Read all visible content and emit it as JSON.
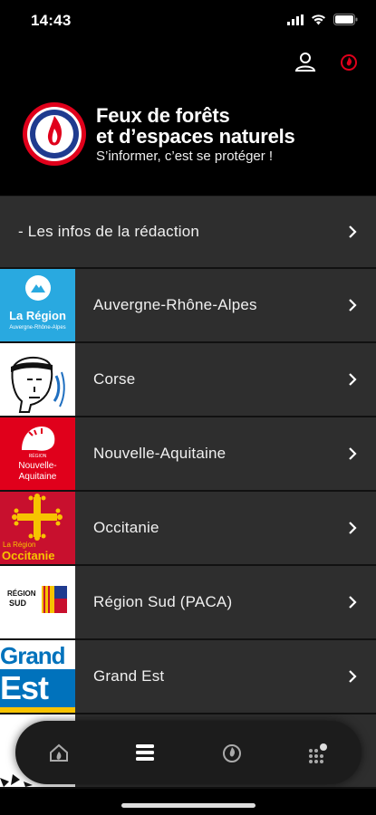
{
  "status": {
    "time": "14:43"
  },
  "header": {
    "title_line1": "Feux de forêts",
    "title_line2": "et d’espaces naturels",
    "tagline": "S’informer, c’est se protéger !"
  },
  "list": {
    "items": [
      {
        "label": "- Les infos de la rédaction"
      },
      {
        "label": "Auvergne-Rhône-Alpes",
        "logo_text": "La Région",
        "logo_sub": "Auvergne-Rhône-Alpes"
      },
      {
        "label": "Corse"
      },
      {
        "label": "Nouvelle-Aquitaine",
        "logo_text": "Nouvelle-",
        "logo_text2": "Aquitaine",
        "logo_small": "RÉGION"
      },
      {
        "label": "Occitanie",
        "logo_text": "La Région",
        "logo_text2": "Occitanie"
      },
      {
        "label": "Région Sud (PACA)",
        "logo_text": "RÉGION",
        "logo_text2": "SUD"
      },
      {
        "label": "Grand Est",
        "logo_text": "Grand",
        "logo_text2": "Est"
      }
    ]
  },
  "colors": {
    "accent_red": "#e0001b",
    "auvergne_blue": "#29a9e0",
    "occitanie_red": "#c8102e",
    "occitanie_gold": "#f7c300",
    "grand_est_blue": "#0072bc"
  }
}
